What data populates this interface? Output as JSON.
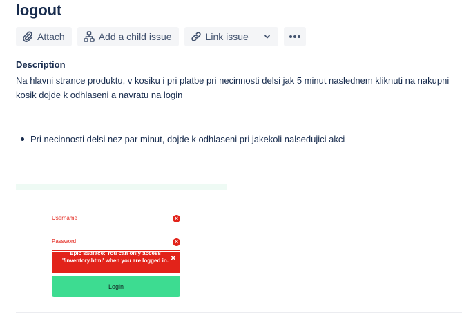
{
  "issue": {
    "title": "logout"
  },
  "toolbar": {
    "attach_label": "Attach",
    "child_issue_label": "Add a child issue",
    "link_issue_label": "Link issue",
    "icons": {
      "attach": "paperclip-icon",
      "child": "hierarchy-icon",
      "link": "link-icon",
      "dropdown": "chevron-down-icon",
      "more": "more-icon"
    }
  },
  "description": {
    "label": "Description",
    "text": "Na hlavni strance produktu, v kosiku i pri platbe pri necinnosti delsi jak 5 minut  naslednem kliknuti na nakupni kosik dojde k odhlaseni a navratu na login",
    "bullets": [
      "Pri necinnosti delsi nez par minut, dojde k odhlaseni pri jakekoli nalsedujici akci"
    ]
  },
  "attachment": {
    "username_placeholder": "Username",
    "password_placeholder": "Password",
    "error_message": "Epic sadface: You can only access '/inventory.html' when you are logged in.",
    "login_label": "Login",
    "colors": {
      "error": "#e2231a",
      "login": "#3ddc91"
    }
  }
}
